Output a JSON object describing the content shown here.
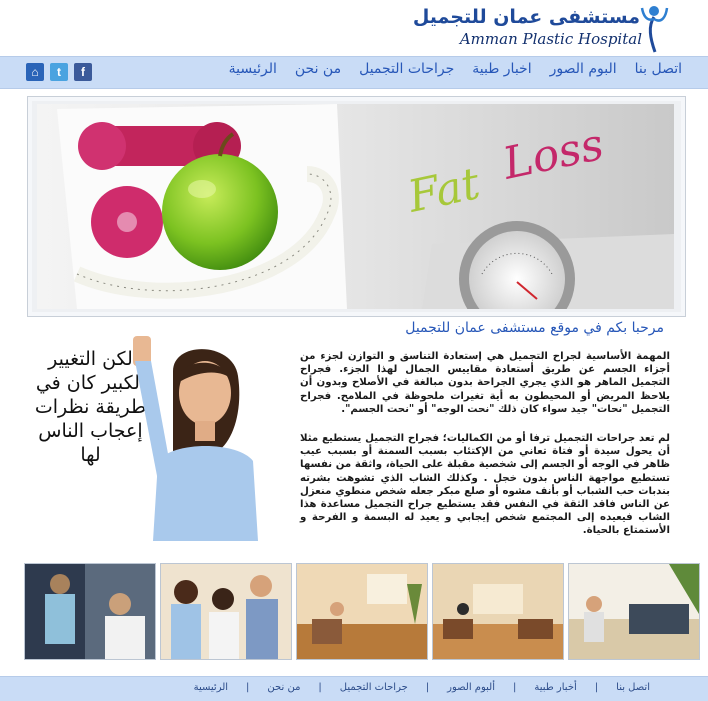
{
  "brand": {
    "name_ar": "مستشفى عمان للتجميل",
    "name_en": "Amman Plastic Hospital"
  },
  "nav": {
    "items": [
      {
        "label": "الرئيسية"
      },
      {
        "label": "من نحن"
      },
      {
        "label": "جراحات التجميل"
      },
      {
        "label": "اخبار طبية"
      },
      {
        "label": "البوم الصور"
      },
      {
        "label": "اتصل بنا"
      }
    ],
    "social": [
      {
        "name": "facebook",
        "glyph": "f",
        "icon": "facebook-icon"
      },
      {
        "name": "twitter",
        "glyph": "t",
        "icon": "twitter-icon"
      },
      {
        "name": "home",
        "glyph": "⌂",
        "icon": "home-icon"
      }
    ]
  },
  "banner": {
    "word1": "Fat",
    "word2": "Loss"
  },
  "main": {
    "welcome": "مرحبا بكم في موقع مستشفى عمان للتجميل",
    "slogan": "لكن التغيير الكبير كان في طريقة نظرات إعجاب الناس لها",
    "paragraph1": "المهمة الأساسية لجراح التجميل هي إستعادة التناسق و التوازن لجزء من أجزاء الجسم عن طريق أستعادة مقاييس الجمال لهذا الجزء. فجراح التجميل الماهر هو الذي يجري الجراحة بدون مبالغة في الأصلاح وبدون أن يلاحظ المريض أو المحيطون به أية تغيرات ملحوظة في الملامح. فجراح التجميل \"نحات\" جيد سواء كان ذلك \"نحت الوجه\" أو \"نحت الجسم\".",
    "paragraph2": "لم تعد جراحات التجميل ترفا أو من الكماليات؛ فجراح التجميل يستطيع مثلا أن يحول سيدة أو فتاة تعاني من الإكتئاب بسبب السمنة أو بسبب عيب ظاهر في الوجه أو الجسم إلى شخصية مقبلة على الحياة، واثقة من نفسها تستطيع مواجهة الناس بدون خجل . وكذلك الشاب الذي تشوهت بشرته بندبات حب الشباب أو بأنف مشوه أو صلع مبكر جعله شخص منطوي منعزل عن الناس فاقد الثقة في النفس فقد يستطيع جراح التجميل مساعدة هذا الشاب فيعيده إلى المجتمع شخص إيجابي و يعيد له البسمة و الفرحة و الأستمتاع بالحياة."
  },
  "footer": {
    "items": [
      {
        "label": "الرئيسية"
      },
      {
        "label": "من نحن"
      },
      {
        "label": "جراحات التجميل"
      },
      {
        "label": "ألبوم الصور"
      },
      {
        "label": "أخبار طبية"
      },
      {
        "label": "اتصل بنا"
      }
    ],
    "separator": "|"
  }
}
